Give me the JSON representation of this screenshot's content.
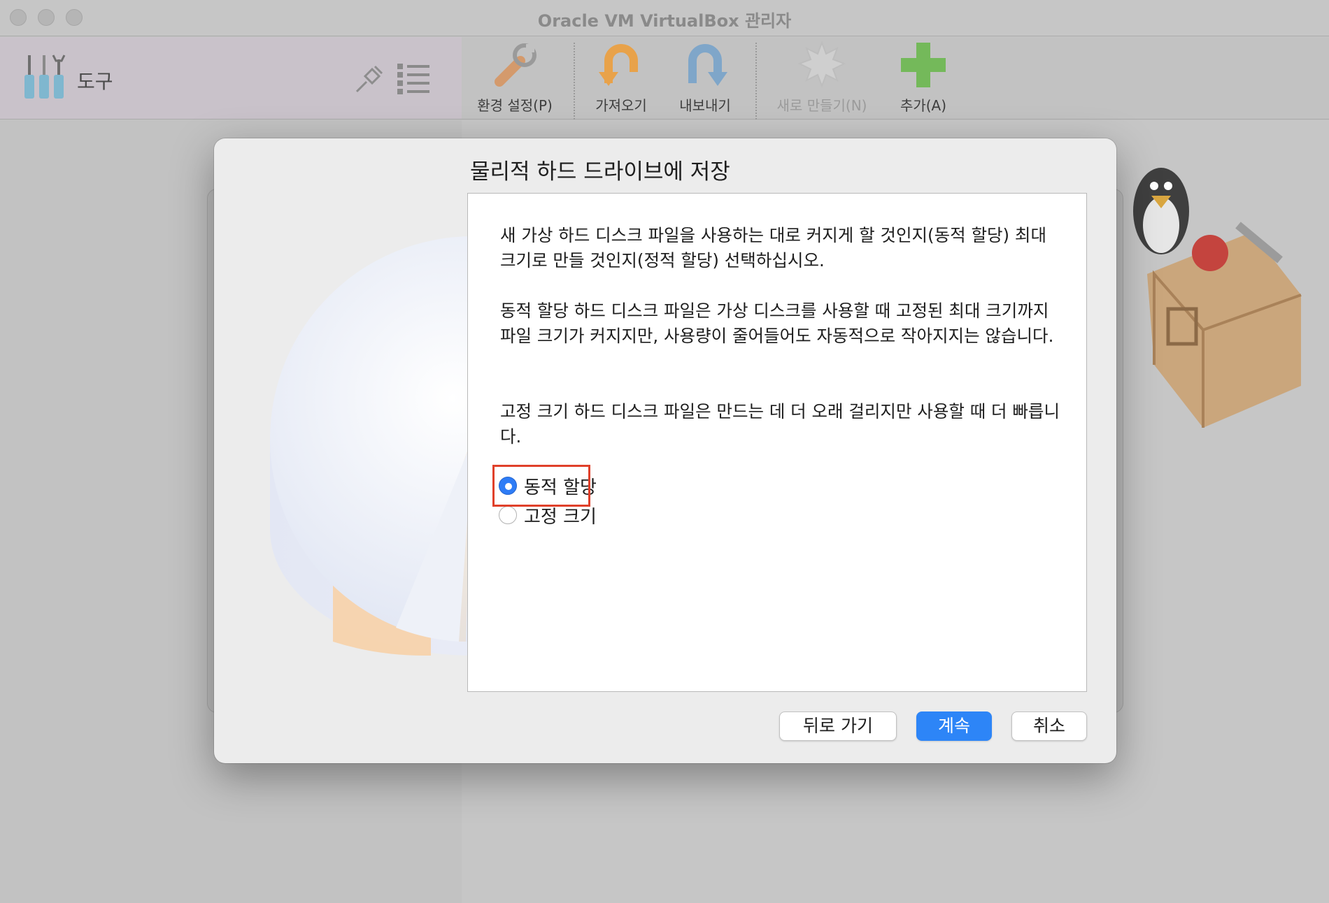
{
  "window": {
    "title": "Oracle VM VirtualBox 관리자"
  },
  "tools": {
    "label": "도구"
  },
  "toolbar": {
    "preferences": "환경 설정(P)",
    "import": "가져오기",
    "export": "내보내기",
    "new": "새로 만들기(N)",
    "add": "추가(A)"
  },
  "dialog": {
    "title": "물리적 하드 드라이브에 저장",
    "paragraphs": [
      "새 가상 하드 디스크 파일을 사용하는 대로 커지게 할 것인지(동적 할당) 최대 크기로 만들 것인지(정적 할당) 선택하십시오.",
      "동적 할당 하드 디스크 파일은 가상 디스크를 사용할 때 고정된 최대 크기까지 파일 크기가 커지지만, 사용량이 줄어들어도 자동적으로 작아지지는 않습니다.",
      "고정 크기 하드 디스크 파일은 만드는 데 더 오래 걸리지만 사용할 때 더 빠릅니다."
    ],
    "options": [
      {
        "label": "동적 할당",
        "checked": true
      },
      {
        "label": "고정 크기",
        "checked": false
      }
    ],
    "buttons": {
      "back": "뒤로 가기",
      "continue": "계속",
      "cancel": "취소"
    }
  }
}
